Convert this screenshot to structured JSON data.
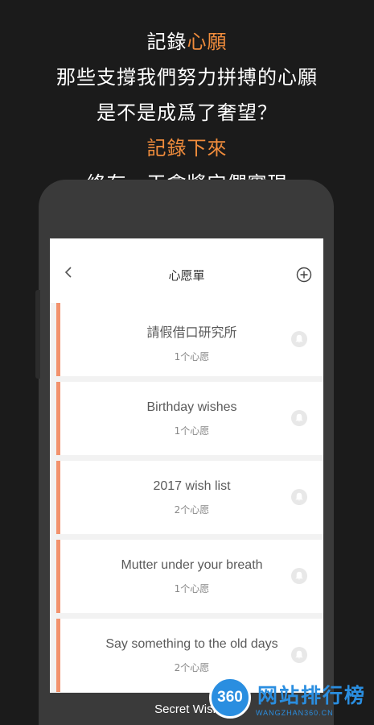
{
  "promo": {
    "line1_prefix": "記錄",
    "line1_accent": "心願",
    "line2": "那些支撐我們努力拼搏的心願",
    "line3": "是不是成爲了奢望？",
    "line4": "記錄下來",
    "line5": "終有一天會將它們實現"
  },
  "nav": {
    "title": "心愿單"
  },
  "lists": [
    {
      "name": "請假借口研究所",
      "count": "1个心愿"
    },
    {
      "name": "Birthday wishes",
      "count": "1个心愿"
    },
    {
      "name": "2017 wish list",
      "count": "2个心愿"
    },
    {
      "name": "Mutter under your breath",
      "count": "1个心愿"
    },
    {
      "name": "Say something to the old days",
      "count": "2个心愿"
    }
  ],
  "bottom_label": "Secret Wish",
  "watermark": {
    "logo": "360",
    "text": "网站排行榜",
    "sub": "WANGZHAN360.CN"
  },
  "colors": {
    "accent": "#f08c3c",
    "card_bar": "#f2926d",
    "background": "#1b1b1b"
  }
}
